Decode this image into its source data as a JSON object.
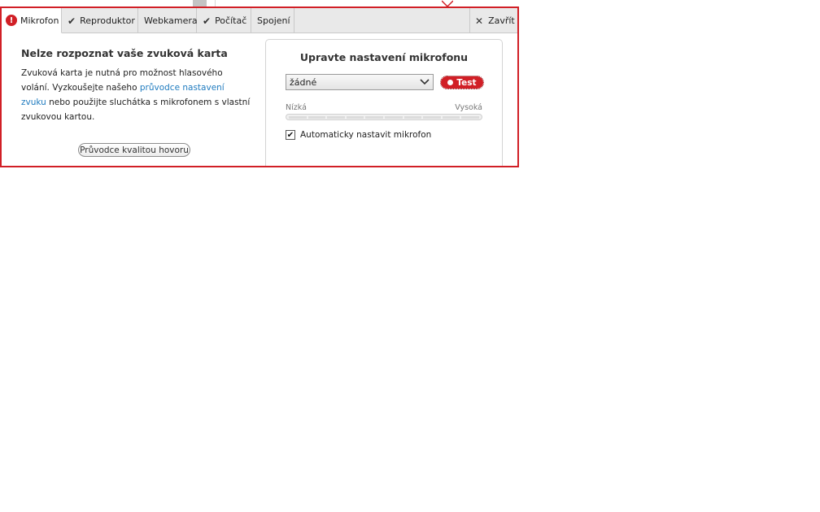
{
  "tabs": [
    {
      "label": "Mikrofon",
      "status": "error"
    },
    {
      "label": "Reproduktor",
      "status": "ok"
    },
    {
      "label": "Webkamera",
      "status": "none"
    },
    {
      "label": "Počítač",
      "status": "ok"
    },
    {
      "label": "Spojení",
      "status": "none"
    }
  ],
  "close_label": "Zavřít",
  "left": {
    "heading": "Nelze rozpoznat vaše zvuková karta",
    "desc_part1": "Zvuková karta je nutná pro možnost hlasového volání. Vyzkoušejte našeho ",
    "desc_link": "průvodce nastavení zvuku",
    "desc_part2": " nebo použijte sluchátka s mikrofonem s vlastní zvukovou kartou.",
    "quality_button": "Průvodce kvalitou hovoru"
  },
  "right": {
    "title": "Upravte nastavení mikrofonu",
    "device_selected": "žádné",
    "test_button": "Test",
    "level_low": "Nízká",
    "level_high": "Vysoká",
    "level_value": 0,
    "auto_checkbox_label": "Automaticky nastavit mikrofon",
    "auto_checked": true
  },
  "colors": {
    "accent": "#d11f26",
    "link": "#1f7bbf"
  },
  "icons": {
    "error": "alert-icon",
    "ok": "check-icon",
    "close": "close-icon",
    "dropdown": "chevron-down-icon",
    "record": "record-dot-icon"
  }
}
